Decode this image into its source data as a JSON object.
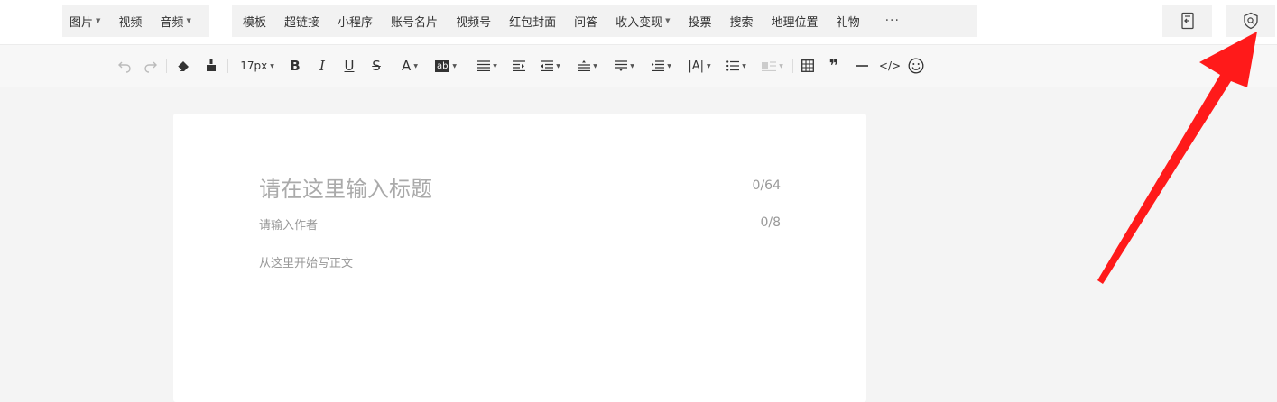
{
  "insert_menu": {
    "items": [
      {
        "label": "图片",
        "has_dropdown": true
      },
      {
        "label": "视频",
        "has_dropdown": false
      },
      {
        "label": "音频",
        "has_dropdown": true
      }
    ]
  },
  "content_menu": {
    "items": [
      {
        "label": "模板"
      },
      {
        "label": "超链接"
      },
      {
        "label": "小程序"
      },
      {
        "label": "账号名片"
      },
      {
        "label": "视频号"
      },
      {
        "label": "红包封面"
      },
      {
        "label": "问答"
      },
      {
        "label": "收入变现"
      },
      {
        "label": "投票"
      },
      {
        "label": "搜索"
      },
      {
        "label": "地理位置"
      },
      {
        "label": "礼物"
      }
    ],
    "more_label": "···"
  },
  "right_actions": {
    "left_icon": "import-document-icon",
    "right_icon": "shield-check-icon"
  },
  "toolbar": {
    "font_size": "17px",
    "icons": [
      "undo-icon",
      "redo-icon",
      "eraser-icon",
      "format-painter-icon",
      "bold-icon",
      "italic-icon",
      "underline-icon",
      "strikethrough-icon",
      "font-color-icon",
      "background-color-icon",
      "align-icon",
      "indent-icon",
      "outdent-icon",
      "line-height-icon",
      "paragraph-spacing-icon",
      "letter-spacing-icon",
      "text-direction-icon",
      "list-icon",
      "block-style-icon",
      "table-icon",
      "quote-icon",
      "divider-icon",
      "code-icon",
      "emoji-icon"
    ]
  },
  "editor": {
    "title_placeholder": "请在这里输入标题",
    "title_count": "0/64",
    "author_placeholder": "请输入作者",
    "author_count": "0/8",
    "body_placeholder": "从这里开始写正文"
  },
  "annotation": {
    "arrow_color": "#ff1a1a"
  }
}
